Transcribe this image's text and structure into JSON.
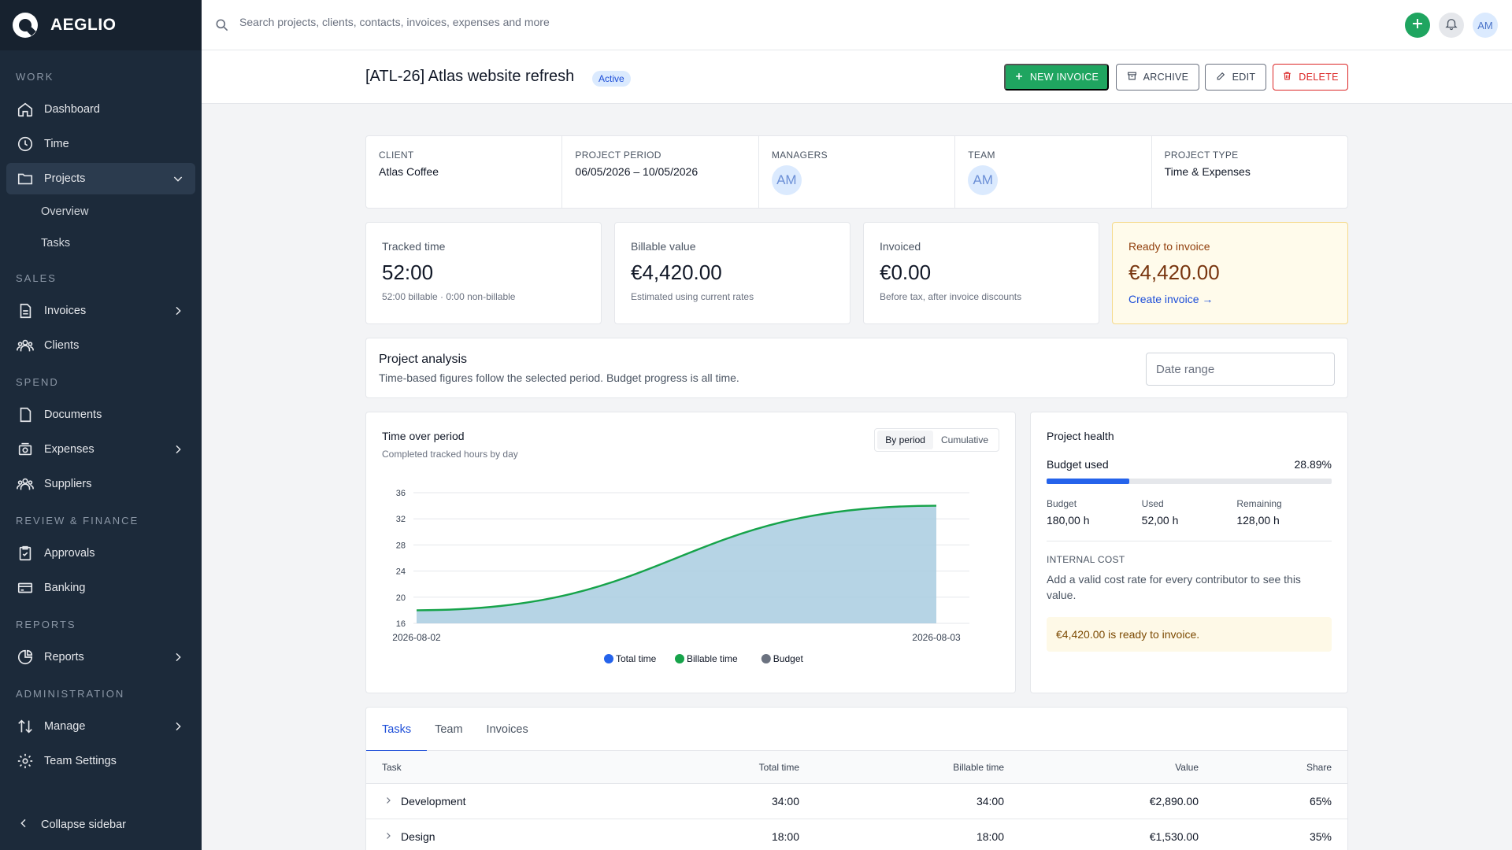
{
  "brand": {
    "name": "AEGLIO"
  },
  "sidebar": {
    "sections": [
      "Work",
      "Sales",
      "Spend",
      "Review & Finance",
      "Reports",
      "Administration"
    ],
    "items": [
      {
        "label": "Dashboard",
        "icon": "home-icon"
      },
      {
        "label": "Time",
        "icon": "clock-icon"
      },
      {
        "label": "Projects",
        "icon": "folder-icon"
      },
      {
        "label": "Invoices",
        "icon": "document-icon"
      },
      {
        "label": "Clients",
        "icon": "users-icon"
      },
      {
        "label": "Documents",
        "icon": "file-icon"
      },
      {
        "label": "Expenses",
        "icon": "receipt-icon"
      },
      {
        "label": "Suppliers",
        "icon": "users-icon"
      },
      {
        "label": "Approvals",
        "icon": "clipboard-check-icon"
      },
      {
        "label": "Banking",
        "icon": "card-icon"
      },
      {
        "label": "Reports",
        "icon": "pie-chart-icon"
      },
      {
        "label": "Manage",
        "icon": "sort-icon"
      },
      {
        "label": "Team Settings",
        "icon": "gear-icon"
      }
    ],
    "subitems": [
      "Overview",
      "Tasks"
    ],
    "collapse_label": "Collapse sidebar"
  },
  "topbar": {
    "search_placeholder": "Search projects, clients, contacts, invoices, expenses and more",
    "avatar": "AM"
  },
  "header": {
    "title": "[ATL-26] Atlas website refresh",
    "status": "Active",
    "buttons": {
      "new_invoice": "NEW INVOICE",
      "archive": "ARCHIVE",
      "edit": "EDIT",
      "delete": "DELETE"
    }
  },
  "info": {
    "client_label": "CLIENT",
    "client": "Atlas Coffee",
    "period_label": "PROJECT PERIOD",
    "period": "06/05/2026 – 10/05/2026",
    "managers_label": "MANAGERS",
    "managers": "AM",
    "team_label": "TEAM",
    "team": "AM",
    "type_label": "PROJECT TYPE",
    "type": "Time & Expenses"
  },
  "stats": [
    {
      "label": "Tracked time",
      "value": "52:00",
      "sub": "52:00 billable · 0:00 non-billable"
    },
    {
      "label": "Billable value",
      "value": "€4,420.00",
      "sub": "Estimated using current rates"
    },
    {
      "label": "Invoiced",
      "value": "€0.00",
      "sub": "Before tax, after invoice discounts"
    },
    {
      "label": "Ready to invoice",
      "value": "€4,420.00",
      "link": "Create invoice →"
    }
  ],
  "analysis": {
    "title": "Project analysis",
    "subtitle": "Time-based figures follow the selected period. Budget progress is all time.",
    "date_placeholder": "Date range"
  },
  "time_chart": {
    "title": "Time over period",
    "subtitle": "Completed tracked hours by day",
    "toggle": [
      "By period",
      "Cumulative"
    ]
  },
  "chart_data": {
    "type": "area",
    "x": [
      "2026-08-02",
      "2026-08-03"
    ],
    "ylim": [
      16,
      36
    ],
    "yticks": [
      16,
      20,
      24,
      28,
      32,
      36
    ],
    "series": [
      {
        "name": "Total time",
        "color": "#2563eb",
        "values": [
          18,
          34
        ]
      },
      {
        "name": "Billable time",
        "color": "#16a34a",
        "values": [
          18,
          34
        ]
      },
      {
        "name": "Budget",
        "color": "#6b7280",
        "values": []
      }
    ],
    "fill_color": "#a9cde0",
    "grid": true,
    "legend": "bottom"
  },
  "health": {
    "title": "Project health",
    "budget_used_label": "Budget used",
    "budget_used": "28.89%",
    "progress": 0.2889,
    "metrics": [
      {
        "label": "Budget",
        "value": "180,00 h"
      },
      {
        "label": "Used",
        "value": "52,00 h"
      },
      {
        "label": "Remaining",
        "value": "128,00 h"
      }
    ],
    "internal_cost_label": "INTERNAL COST",
    "internal_cost_text": "Add a valid cost rate for every contributor to see this value.",
    "ready_note": "€4,420.00 is ready to invoice."
  },
  "tabs": [
    "Tasks",
    "Team",
    "Invoices"
  ],
  "table": {
    "columns": [
      "Task",
      "Total time",
      "Billable time",
      "Value",
      "Share"
    ],
    "rows": [
      {
        "task": "Development",
        "total": "34:00",
        "billable": "34:00",
        "value": "€2,890.00",
        "share": "65%"
      },
      {
        "task": "Design",
        "total": "18:00",
        "billable": "18:00",
        "value": "€1,530.00",
        "share": "35%"
      }
    ]
  }
}
